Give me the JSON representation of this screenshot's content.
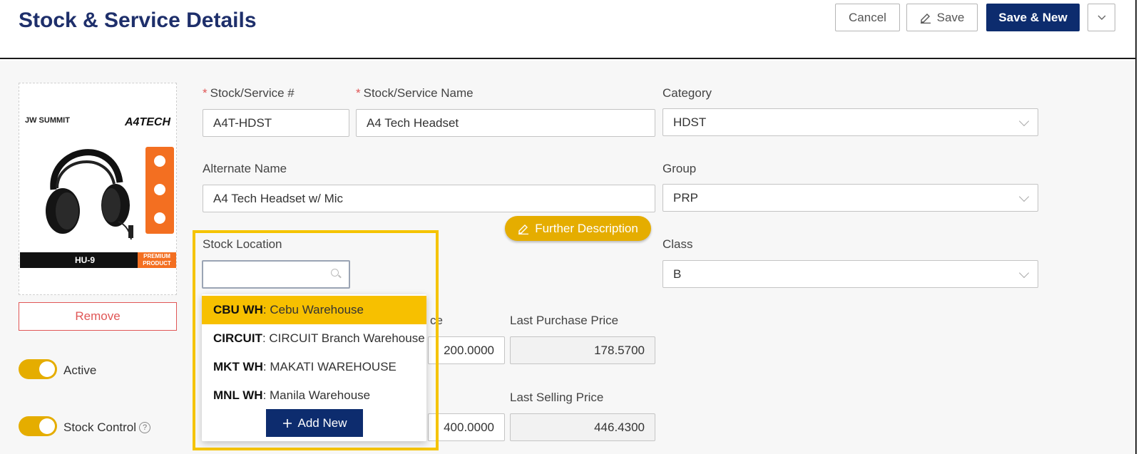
{
  "header": {
    "title": "Stock & Service Details",
    "cancel_label": "Cancel",
    "save_label": "Save",
    "save_new_label": "Save & New"
  },
  "image": {
    "brand_left": "JW SUMMIT",
    "brand_right": "A4TECH",
    "model": "HU-9",
    "badge": "PREMIUM PRODUCT",
    "remove_label": "Remove"
  },
  "toggles": {
    "active_label": "Active",
    "active_on": true,
    "stock_control_label": "Stock Control",
    "stock_control_on": true
  },
  "form": {
    "stock_no_label": "Stock/Service #",
    "stock_no_value": "A4T-HDST",
    "stock_name_label": "Stock/Service Name",
    "stock_name_value": "A4 Tech Headset",
    "category_label": "Category",
    "category_value": "HDST",
    "alternate_name_label": "Alternate Name",
    "alternate_name_value": "A4 Tech Headset w/ Mic",
    "group_label": "Group",
    "group_value": "PRP",
    "further_description_label": "Further Description",
    "stock_location_label": "Stock Location",
    "stock_location_value": "",
    "class_label": "Class",
    "class_value": "B",
    "purchase_price_label_partial": "ce",
    "purchase_price_value": "200.0000",
    "last_purchase_price_label": "Last Purchase Price",
    "last_purchase_price_value": "178.5700",
    "selling_price_value": "400.0000",
    "last_selling_price_label": "Last Selling Price",
    "last_selling_price_value": "446.4300"
  },
  "location_dropdown": {
    "options": [
      {
        "code": "CBU WH",
        "name": ": Cebu Warehouse",
        "selected": true
      },
      {
        "code": "CIRCUIT",
        "name": ": CIRCUIT Branch Warehouse",
        "selected": false
      },
      {
        "code": "MKT WH",
        "name": ": MAKATI WAREHOUSE",
        "selected": false
      },
      {
        "code": "MNL WH",
        "name": ": Manila Warehouse",
        "selected": false
      }
    ],
    "add_new_label": "Add New"
  },
  "colors": {
    "primary": "#0d2c6e",
    "accent": "#e5ad00",
    "highlight": "#f5c400",
    "danger": "#e05656"
  }
}
